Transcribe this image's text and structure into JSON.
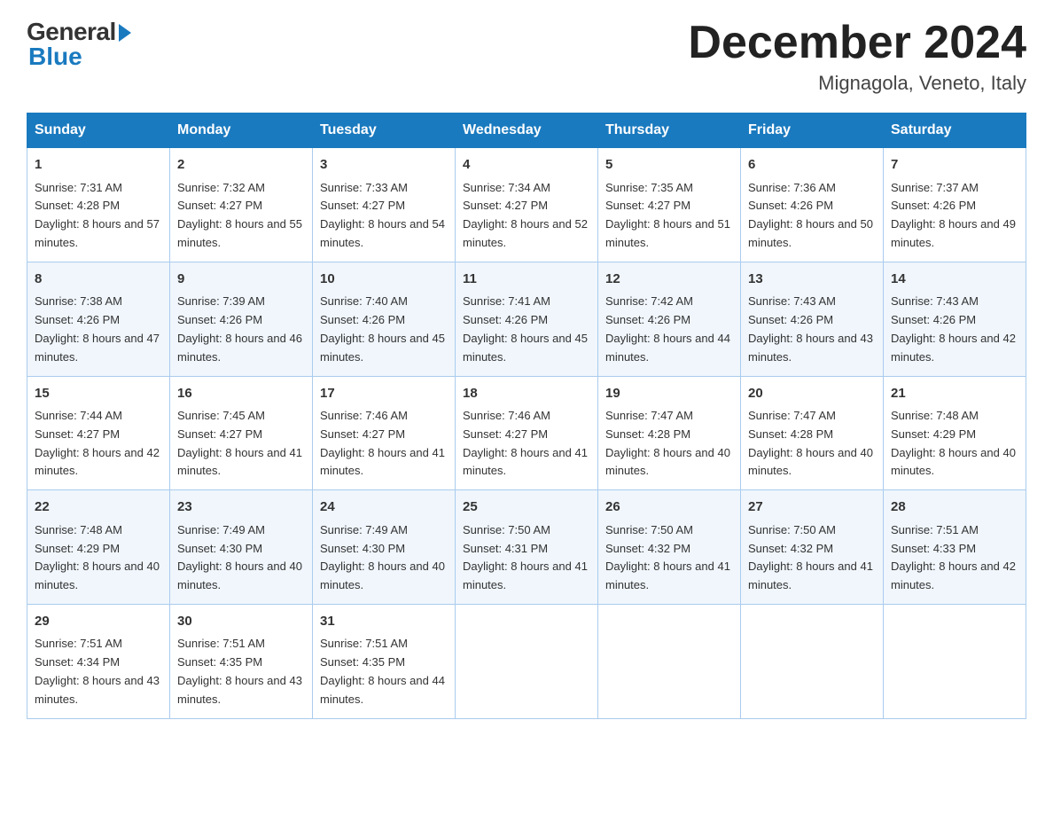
{
  "header": {
    "logo_general": "General",
    "logo_blue": "Blue",
    "month_title": "December 2024",
    "location": "Mignagola, Veneto, Italy"
  },
  "days_of_week": [
    "Sunday",
    "Monday",
    "Tuesday",
    "Wednesday",
    "Thursday",
    "Friday",
    "Saturday"
  ],
  "weeks": [
    [
      {
        "day": "1",
        "sunrise": "Sunrise: 7:31 AM",
        "sunset": "Sunset: 4:28 PM",
        "daylight": "Daylight: 8 hours and 57 minutes."
      },
      {
        "day": "2",
        "sunrise": "Sunrise: 7:32 AM",
        "sunset": "Sunset: 4:27 PM",
        "daylight": "Daylight: 8 hours and 55 minutes."
      },
      {
        "day": "3",
        "sunrise": "Sunrise: 7:33 AM",
        "sunset": "Sunset: 4:27 PM",
        "daylight": "Daylight: 8 hours and 54 minutes."
      },
      {
        "day": "4",
        "sunrise": "Sunrise: 7:34 AM",
        "sunset": "Sunset: 4:27 PM",
        "daylight": "Daylight: 8 hours and 52 minutes."
      },
      {
        "day": "5",
        "sunrise": "Sunrise: 7:35 AM",
        "sunset": "Sunset: 4:27 PM",
        "daylight": "Daylight: 8 hours and 51 minutes."
      },
      {
        "day": "6",
        "sunrise": "Sunrise: 7:36 AM",
        "sunset": "Sunset: 4:26 PM",
        "daylight": "Daylight: 8 hours and 50 minutes."
      },
      {
        "day": "7",
        "sunrise": "Sunrise: 7:37 AM",
        "sunset": "Sunset: 4:26 PM",
        "daylight": "Daylight: 8 hours and 49 minutes."
      }
    ],
    [
      {
        "day": "8",
        "sunrise": "Sunrise: 7:38 AM",
        "sunset": "Sunset: 4:26 PM",
        "daylight": "Daylight: 8 hours and 47 minutes."
      },
      {
        "day": "9",
        "sunrise": "Sunrise: 7:39 AM",
        "sunset": "Sunset: 4:26 PM",
        "daylight": "Daylight: 8 hours and 46 minutes."
      },
      {
        "day": "10",
        "sunrise": "Sunrise: 7:40 AM",
        "sunset": "Sunset: 4:26 PM",
        "daylight": "Daylight: 8 hours and 45 minutes."
      },
      {
        "day": "11",
        "sunrise": "Sunrise: 7:41 AM",
        "sunset": "Sunset: 4:26 PM",
        "daylight": "Daylight: 8 hours and 45 minutes."
      },
      {
        "day": "12",
        "sunrise": "Sunrise: 7:42 AM",
        "sunset": "Sunset: 4:26 PM",
        "daylight": "Daylight: 8 hours and 44 minutes."
      },
      {
        "day": "13",
        "sunrise": "Sunrise: 7:43 AM",
        "sunset": "Sunset: 4:26 PM",
        "daylight": "Daylight: 8 hours and 43 minutes."
      },
      {
        "day": "14",
        "sunrise": "Sunrise: 7:43 AM",
        "sunset": "Sunset: 4:26 PM",
        "daylight": "Daylight: 8 hours and 42 minutes."
      }
    ],
    [
      {
        "day": "15",
        "sunrise": "Sunrise: 7:44 AM",
        "sunset": "Sunset: 4:27 PM",
        "daylight": "Daylight: 8 hours and 42 minutes."
      },
      {
        "day": "16",
        "sunrise": "Sunrise: 7:45 AM",
        "sunset": "Sunset: 4:27 PM",
        "daylight": "Daylight: 8 hours and 41 minutes."
      },
      {
        "day": "17",
        "sunrise": "Sunrise: 7:46 AM",
        "sunset": "Sunset: 4:27 PM",
        "daylight": "Daylight: 8 hours and 41 minutes."
      },
      {
        "day": "18",
        "sunrise": "Sunrise: 7:46 AM",
        "sunset": "Sunset: 4:27 PM",
        "daylight": "Daylight: 8 hours and 41 minutes."
      },
      {
        "day": "19",
        "sunrise": "Sunrise: 7:47 AM",
        "sunset": "Sunset: 4:28 PM",
        "daylight": "Daylight: 8 hours and 40 minutes."
      },
      {
        "day": "20",
        "sunrise": "Sunrise: 7:47 AM",
        "sunset": "Sunset: 4:28 PM",
        "daylight": "Daylight: 8 hours and 40 minutes."
      },
      {
        "day": "21",
        "sunrise": "Sunrise: 7:48 AM",
        "sunset": "Sunset: 4:29 PM",
        "daylight": "Daylight: 8 hours and 40 minutes."
      }
    ],
    [
      {
        "day": "22",
        "sunrise": "Sunrise: 7:48 AM",
        "sunset": "Sunset: 4:29 PM",
        "daylight": "Daylight: 8 hours and 40 minutes."
      },
      {
        "day": "23",
        "sunrise": "Sunrise: 7:49 AM",
        "sunset": "Sunset: 4:30 PM",
        "daylight": "Daylight: 8 hours and 40 minutes."
      },
      {
        "day": "24",
        "sunrise": "Sunrise: 7:49 AM",
        "sunset": "Sunset: 4:30 PM",
        "daylight": "Daylight: 8 hours and 40 minutes."
      },
      {
        "day": "25",
        "sunrise": "Sunrise: 7:50 AM",
        "sunset": "Sunset: 4:31 PM",
        "daylight": "Daylight: 8 hours and 41 minutes."
      },
      {
        "day": "26",
        "sunrise": "Sunrise: 7:50 AM",
        "sunset": "Sunset: 4:32 PM",
        "daylight": "Daylight: 8 hours and 41 minutes."
      },
      {
        "day": "27",
        "sunrise": "Sunrise: 7:50 AM",
        "sunset": "Sunset: 4:32 PM",
        "daylight": "Daylight: 8 hours and 41 minutes."
      },
      {
        "day": "28",
        "sunrise": "Sunrise: 7:51 AM",
        "sunset": "Sunset: 4:33 PM",
        "daylight": "Daylight: 8 hours and 42 minutes."
      }
    ],
    [
      {
        "day": "29",
        "sunrise": "Sunrise: 7:51 AM",
        "sunset": "Sunset: 4:34 PM",
        "daylight": "Daylight: 8 hours and 43 minutes."
      },
      {
        "day": "30",
        "sunrise": "Sunrise: 7:51 AM",
        "sunset": "Sunset: 4:35 PM",
        "daylight": "Daylight: 8 hours and 43 minutes."
      },
      {
        "day": "31",
        "sunrise": "Sunrise: 7:51 AM",
        "sunset": "Sunset: 4:35 PM",
        "daylight": "Daylight: 8 hours and 44 minutes."
      },
      null,
      null,
      null,
      null
    ]
  ]
}
